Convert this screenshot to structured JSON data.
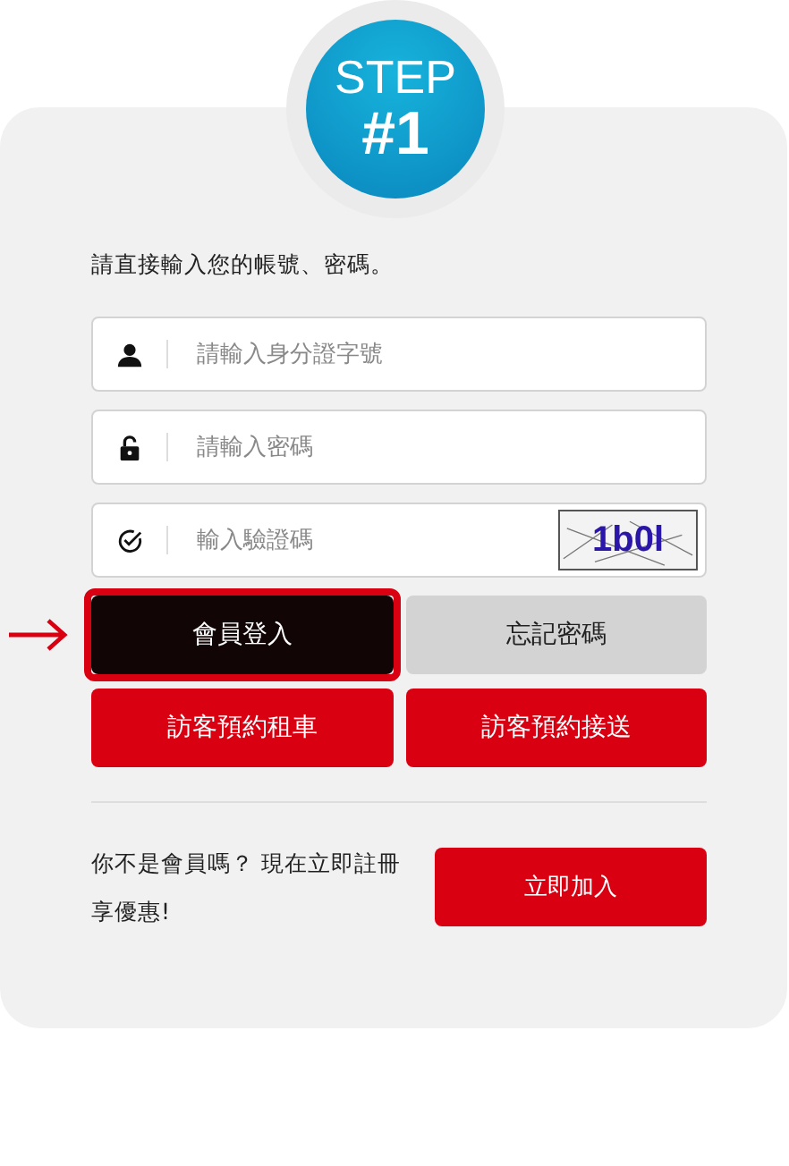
{
  "badge": {
    "line1": "STEP",
    "line2": "#1"
  },
  "instruction": "請直接輸入您的帳號、密碼。",
  "fields": [
    {
      "kind": "user",
      "placeholder": "請輸入身分證字號"
    },
    {
      "kind": "lock",
      "placeholder": "請輸入密碼"
    },
    {
      "kind": "captcha",
      "placeholder": "輸入驗證碼",
      "captcha": "1b0l"
    }
  ],
  "buttons": [
    {
      "label": "會員登入",
      "kind": "dark",
      "highlighted": true
    },
    {
      "label": "忘記密碼",
      "kind": "grey",
      "highlighted": false
    },
    {
      "label": "訪客預約租車",
      "kind": "red",
      "highlighted": false
    },
    {
      "label": "訪客預約接送",
      "kind": "red",
      "highlighted": false
    }
  ],
  "signup": {
    "text": "你不是會員嗎？ 現在立即註冊享優惠!",
    "button": "立即加入"
  }
}
